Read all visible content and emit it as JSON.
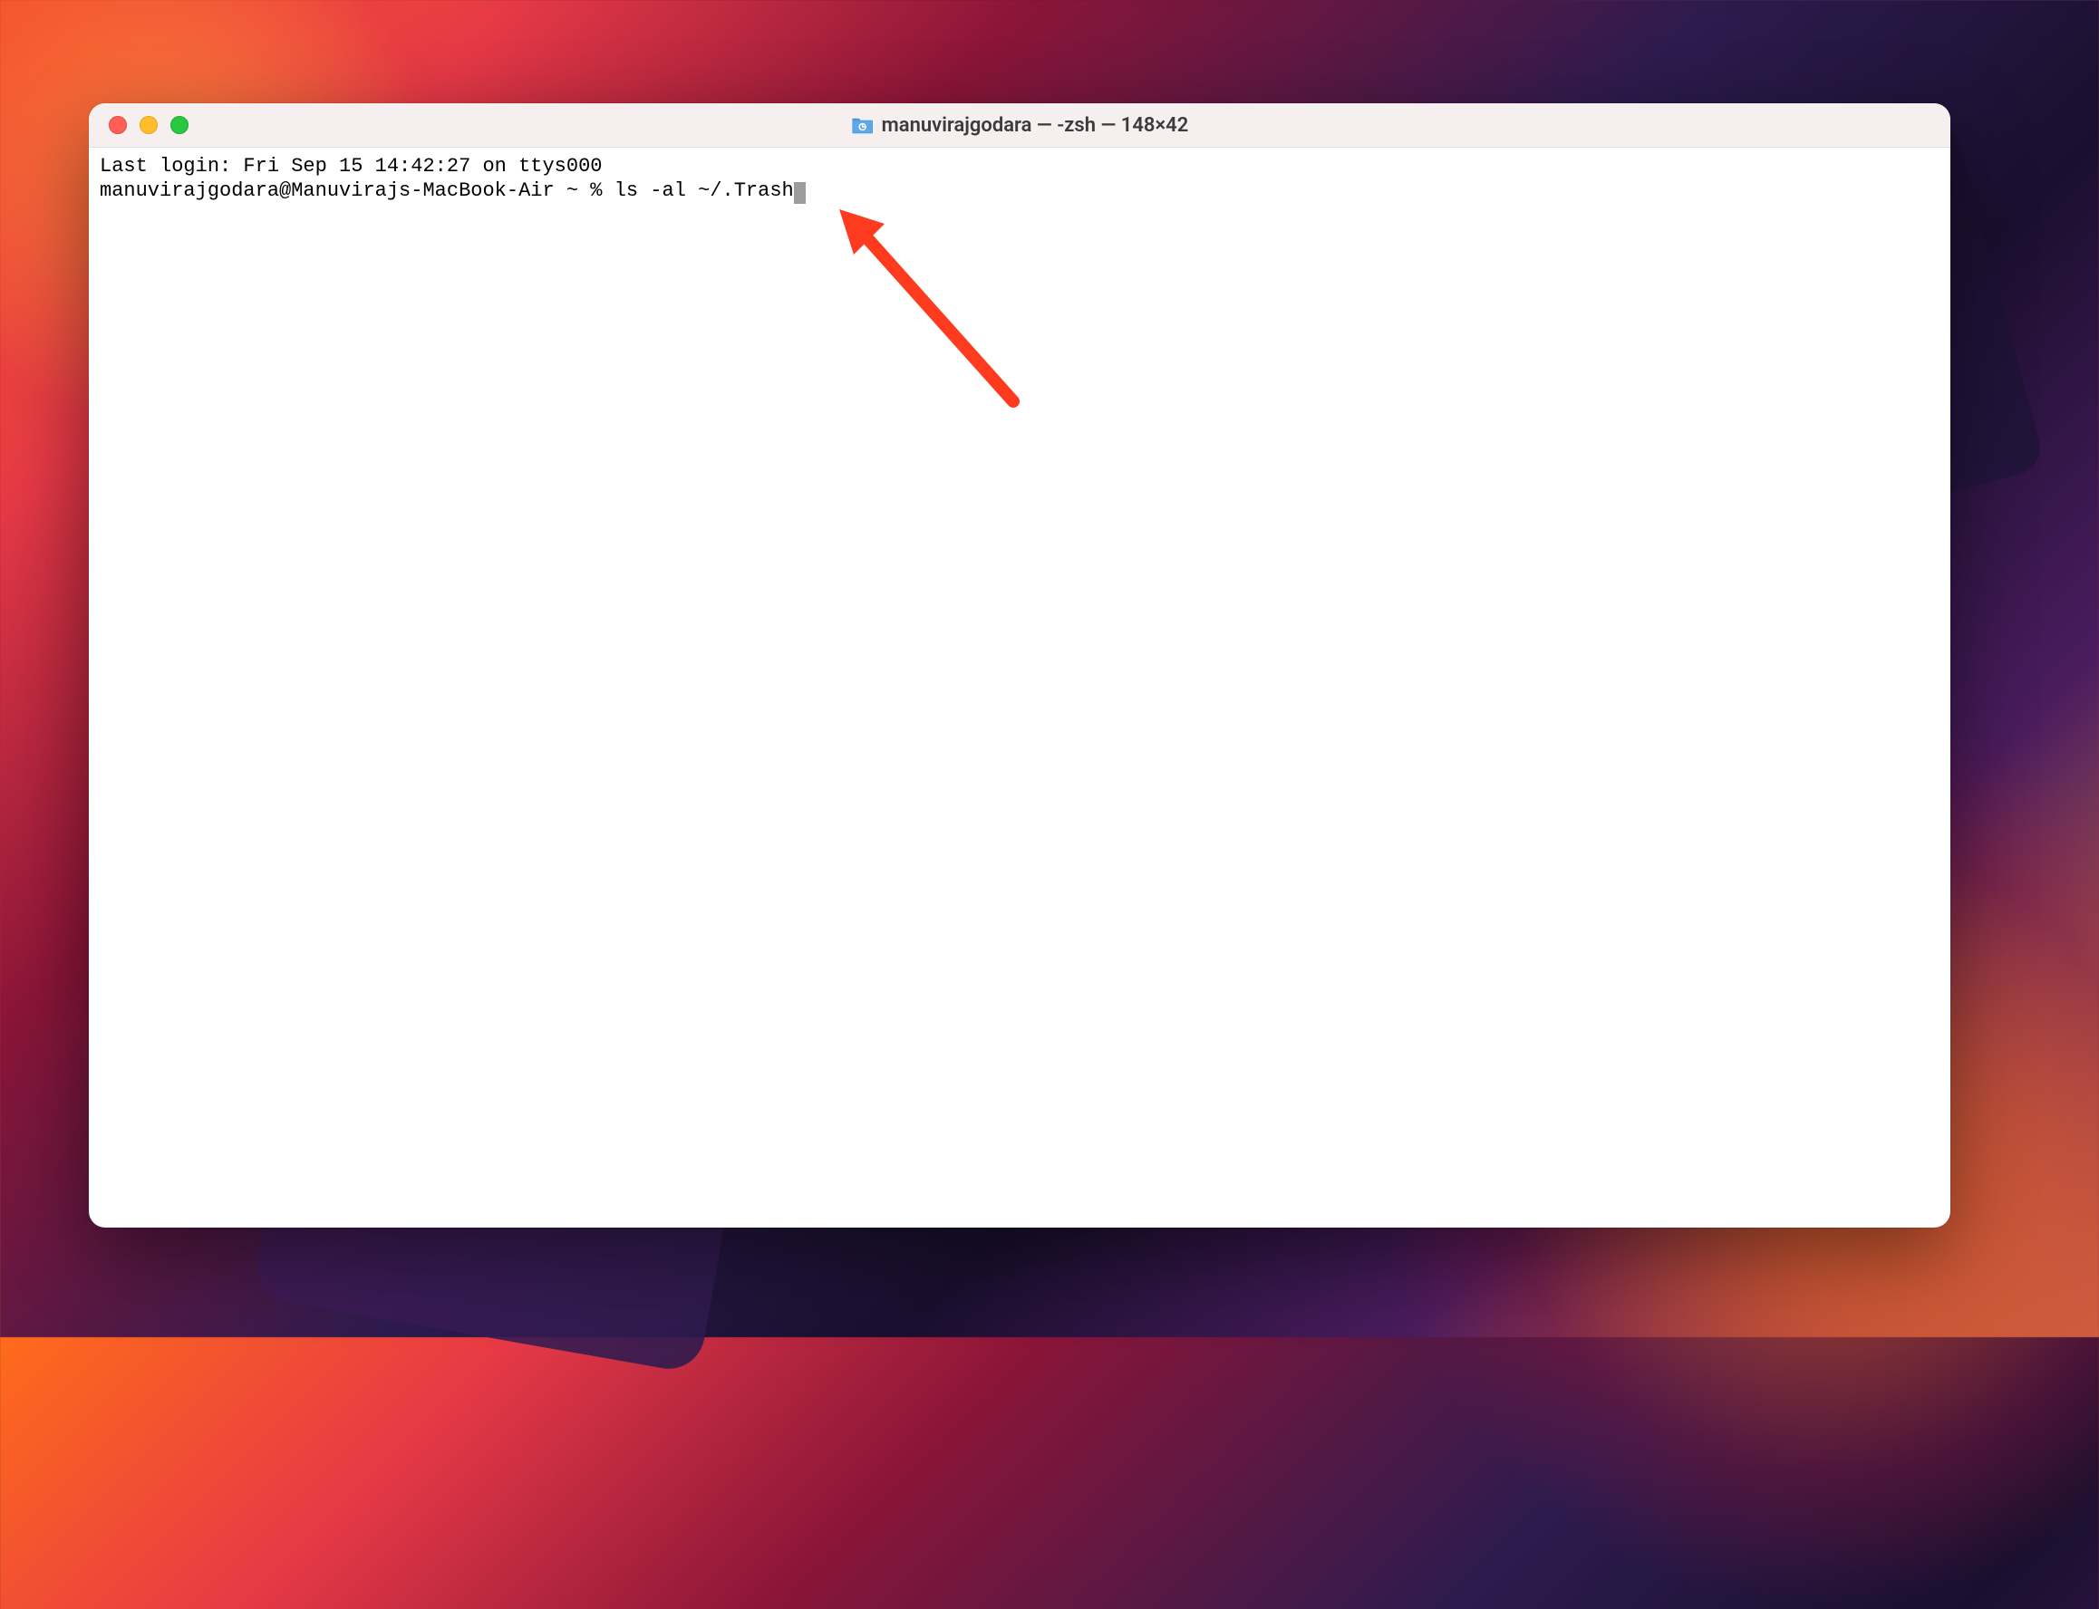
{
  "window": {
    "title": "manuvirajgodara — -zsh — 148×42"
  },
  "terminal": {
    "lines": [
      "Last login: Fri Sep 15 14:42:27 on ttys000"
    ],
    "prompt": "manuvirajgodara@Manuvirajs-MacBook-Air ~ % ",
    "command": "ls -al ~/.Trash"
  }
}
